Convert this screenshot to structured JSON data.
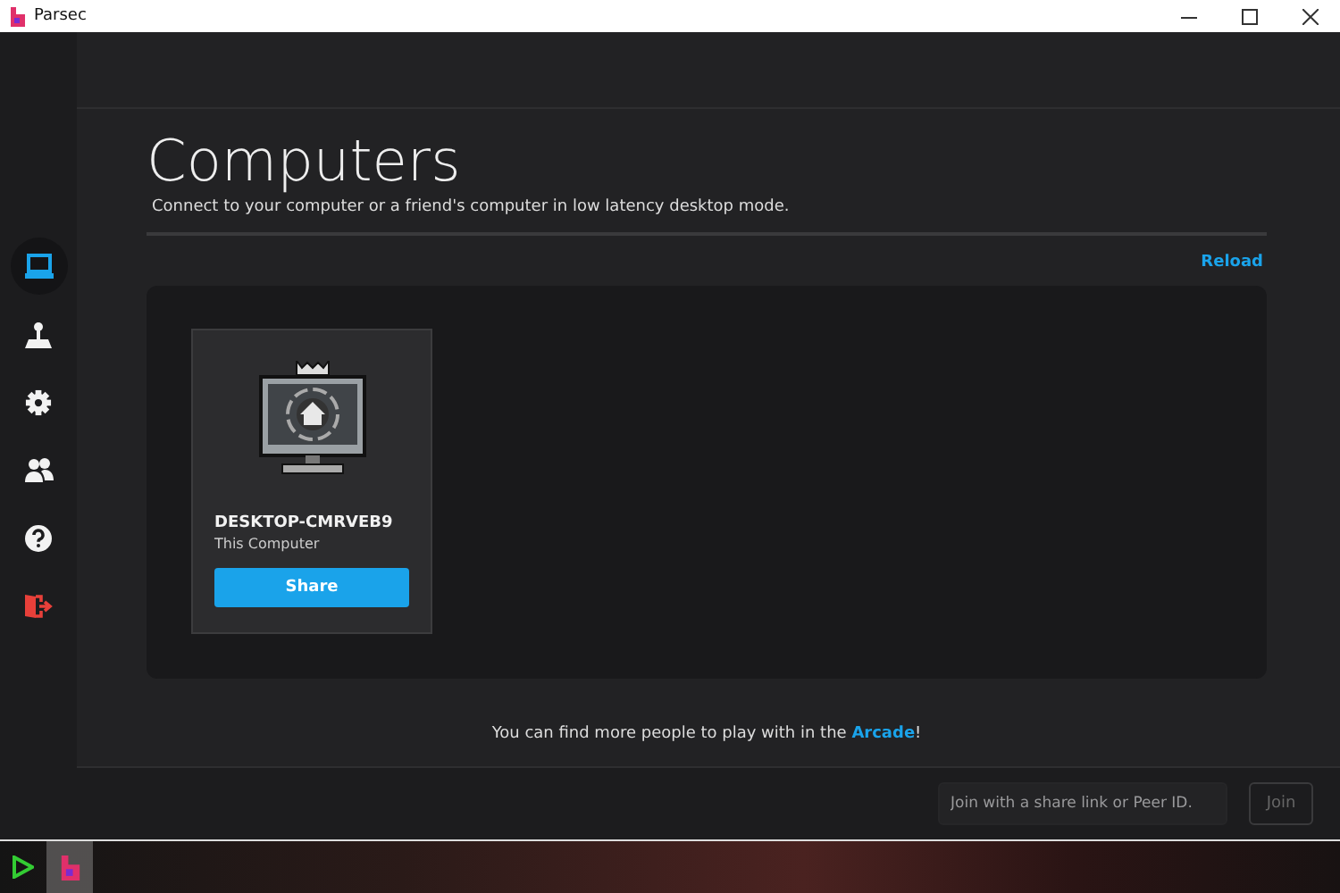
{
  "window": {
    "title": "Parsec"
  },
  "sidebar": {
    "items": [
      {
        "selected": true
      },
      {
        "selected": false
      },
      {
        "selected": false
      },
      {
        "selected": false
      },
      {
        "selected": false
      },
      {
        "selected": false
      }
    ]
  },
  "page": {
    "title": "Computers",
    "subtitle": "Connect to your computer or a friend's computer in low latency desktop mode.",
    "reload": "Reload"
  },
  "computers": [
    {
      "name": "DESKTOP-CMRVEB9",
      "description": "This Computer",
      "button": "Share"
    }
  ],
  "footer_note": {
    "text": "You can find more people to play with in the ",
    "link": "Arcade",
    "end": "!"
  },
  "join": {
    "placeholder": "Join with a share link or Peer ID.",
    "button": "Join",
    "disabled": true
  },
  "taskbar": {
    "apps": [
      {
        "selected": false
      },
      {
        "selected": true
      }
    ]
  }
}
